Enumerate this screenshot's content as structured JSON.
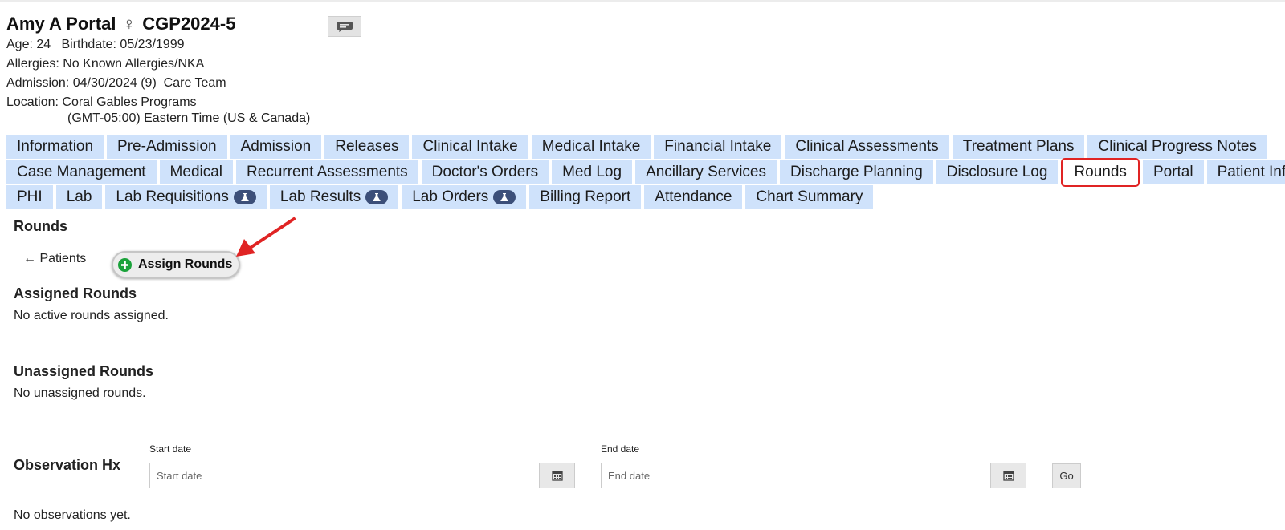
{
  "patient": {
    "name": "Amy A Portal",
    "gender_symbol": "♀",
    "id": "CGP2024-5",
    "age_line": "Age: 24   Birthdate: 05/23/1999",
    "allergies_line": "Allergies: No Known Allergies/NKA",
    "admission_line": "Admission: 04/30/2024 (9)  Care Team",
    "location_line": "Location: Coral Gables Programs",
    "timezone_line": "(GMT-05:00) Eastern Time (US & Canada)"
  },
  "tabs": {
    "row1": [
      "Information",
      "Pre-Admission",
      "Admission",
      "Releases",
      "Clinical Intake",
      "Medical Intake",
      "Financial Intake",
      "Clinical Assessments",
      "Treatment Plans",
      "Clinical Progress Notes"
    ],
    "row2": [
      "Case Management",
      "Medical",
      "Recurrent Assessments",
      "Doctor's Orders",
      "Med Log",
      "Ancillary Services",
      "Discharge Planning",
      "Disclosure Log",
      "Rounds",
      "Portal",
      "Patient Info"
    ],
    "row3": [
      "PHI",
      "Lab",
      "Lab Requisitions",
      "Lab Results",
      "Lab Orders",
      "Billing Report",
      "Attendance",
      "Chart Summary"
    ],
    "active": "Rounds"
  },
  "rounds": {
    "heading": "Rounds",
    "back_link": "← Patients",
    "assign_button": "Assign Rounds",
    "assigned_heading": "Assigned Rounds",
    "assigned_empty": "No active rounds assigned.",
    "unassigned_heading": "Unassigned Rounds",
    "unassigned_empty": "No unassigned rounds."
  },
  "observation": {
    "heading": "Observation Hx",
    "start_label": "Start date",
    "start_placeholder": "Start date",
    "end_label": "End date",
    "end_placeholder": "End date",
    "go_label": "Go",
    "empty": "No observations yet."
  },
  "colors": {
    "tab_bg": "#cfe2fb",
    "highlight": "#e02424",
    "badge": "#3c4f79",
    "add_icon": "#1aa23a"
  },
  "icons": {
    "chat": "chat-bubble-icon",
    "flask": "flask-icon",
    "calendar": "calendar-icon",
    "add": "plus-circle-icon",
    "annotation": "red-arrow-icon"
  }
}
